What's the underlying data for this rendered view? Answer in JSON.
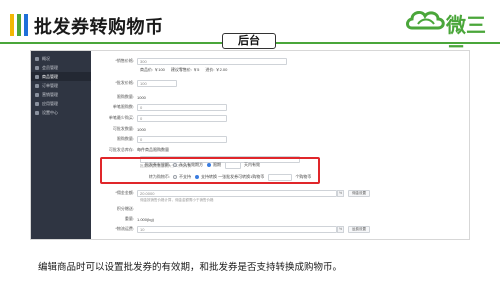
{
  "header": {
    "title": "批发券转购物币",
    "brand_name": "微三云",
    "accent_colors": [
      "#f2b705",
      "#4aa63a",
      "#1e6fd9"
    ]
  },
  "section_tag": "后台",
  "sidebar": {
    "items": [
      {
        "label": "概况",
        "active": false
      },
      {
        "label": "会员管理",
        "active": false
      },
      {
        "label": "商品管理",
        "active": true
      },
      {
        "label": "订单管理",
        "active": false
      },
      {
        "label": "营销管理",
        "active": false
      },
      {
        "label": "应用管理",
        "active": false
      },
      {
        "label": "设置中心",
        "active": false
      }
    ]
  },
  "form": {
    "row1": {
      "label": "*销售价格:",
      "value": "300"
    },
    "row1_sub": {
      "a": "商品价: ￥100",
      "b": "建议零售价: ￥5",
      "c": "进价: ￥2.00"
    },
    "row2": {
      "label": "*批发价格:",
      "value": "100"
    },
    "row3": {
      "label": "限购数量:",
      "value": "1000"
    },
    "row4": {
      "label": "单笔限购数:",
      "value": "0"
    },
    "row5": {
      "label": "单笔最少购买:",
      "value": "0"
    },
    "row6": {
      "label": "可批发数量:",
      "value": "1000"
    },
    "row7": {
      "label": "限购数量:",
      "value": "0"
    },
    "row8": {
      "label": "可批发总库存:",
      "value": "每件商品限购数量"
    },
    "row8_hint": "批发券限购数量需大于0才可转换",
    "hl_row1": {
      "label": "批发券有效期:",
      "opt1": "永久有效期方",
      "opt2": "限期",
      "opt3": "天内有效"
    },
    "hl_row2": {
      "label": "转为购物币:",
      "opt1": "不支持",
      "opt2": "支持转换 一张批发券可转换1购物币",
      "suffix": "个购物币"
    },
    "row9": {
      "label": "*佣金金额:",
      "value": "20.0000",
      "unit": "%",
      "btn": "佣金设置"
    },
    "row9_hint": "佣金按销售价格计算，佣金金额需小于销售价格",
    "row10": {
      "label": "积分赠送:",
      "value": ""
    },
    "row11": {
      "label": "重量:",
      "value": "1.000(kg)"
    },
    "row12": {
      "label": "*物流运费:",
      "value": "10",
      "unit": "%",
      "btn": "运费设置"
    }
  },
  "caption": "编辑商品时可以设置批发券的有效期，和批发券是否支持转换成购物币。"
}
